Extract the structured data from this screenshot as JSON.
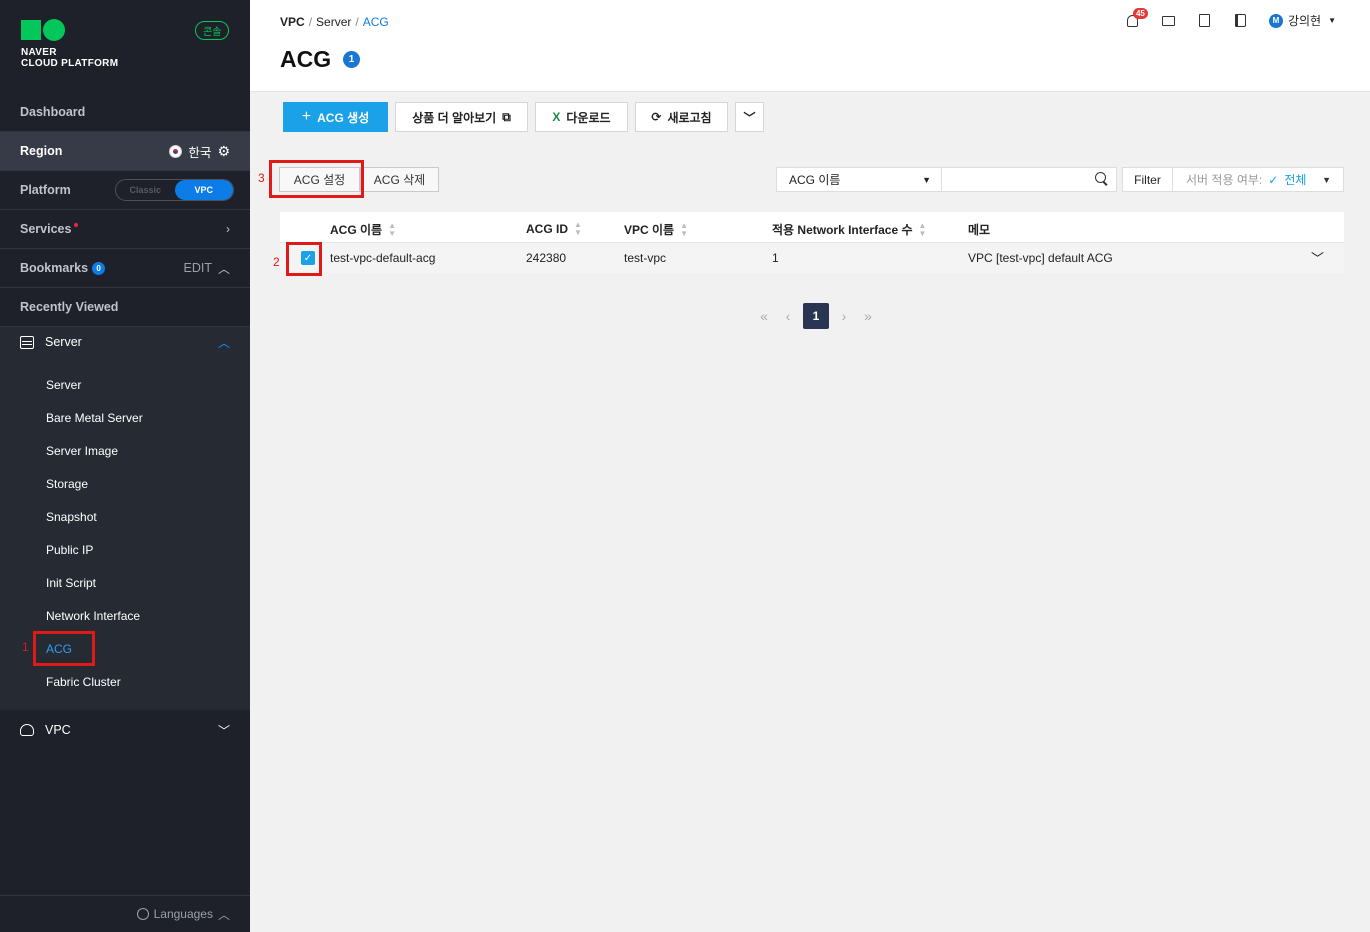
{
  "sidebar": {
    "logo_line1": "NAVER",
    "logo_line2": "CLOUD PLATFORM",
    "console_badge": "콘솔",
    "dashboard": "Dashboard",
    "region_label": "Region",
    "region_value": "한국",
    "platform_label": "Platform",
    "platform_classic": "Classic",
    "platform_vpc": "VPC",
    "services": "Services",
    "bookmarks": "Bookmarks",
    "bookmarks_count": "0",
    "bookmarks_edit": "EDIT",
    "recently_viewed": "Recently Viewed",
    "server_group": "Server",
    "server_items": [
      "Server",
      "Bare Metal Server",
      "Server Image",
      "Storage",
      "Snapshot",
      "Public IP",
      "Init Script",
      "Network Interface",
      "ACG",
      "Fabric Cluster"
    ],
    "vpc_group": "VPC",
    "languages": "Languages"
  },
  "header": {
    "breadcrumb": [
      "VPC",
      "Server",
      "ACG"
    ],
    "title": "ACG",
    "title_count": "1",
    "notif_count": "45",
    "user_initial": "M",
    "user_name": "강의현"
  },
  "toolbar": {
    "create": "ACG 생성",
    "learn_more": "상품 더 알아보기",
    "download": "다운로드",
    "refresh": "새로고침"
  },
  "actions": {
    "settings": "ACG 설정",
    "delete": "ACG 삭제"
  },
  "search": {
    "select_value": "ACG 이름",
    "input_value": "",
    "filter_label": "Filter",
    "filter_field": "서버 적용 여부:",
    "filter_value": "전체"
  },
  "table": {
    "columns": [
      "ACG 이름",
      "ACG ID",
      "VPC 이름",
      "적용 Network Interface 수",
      "메모"
    ],
    "rows": [
      {
        "name": "test-vpc-default-acg",
        "id": "242380",
        "vpc": "test-vpc",
        "ni_count": "1",
        "memo": "VPC [test-vpc] default ACG"
      }
    ]
  },
  "pager": {
    "current": "1"
  },
  "annotations": [
    "1",
    "2",
    "3"
  ],
  "colors": {
    "sidebar_bg": "#1e2129",
    "primary": "#1aa1e8",
    "highlight": "#e01919",
    "brand_green": "#03c75a"
  }
}
